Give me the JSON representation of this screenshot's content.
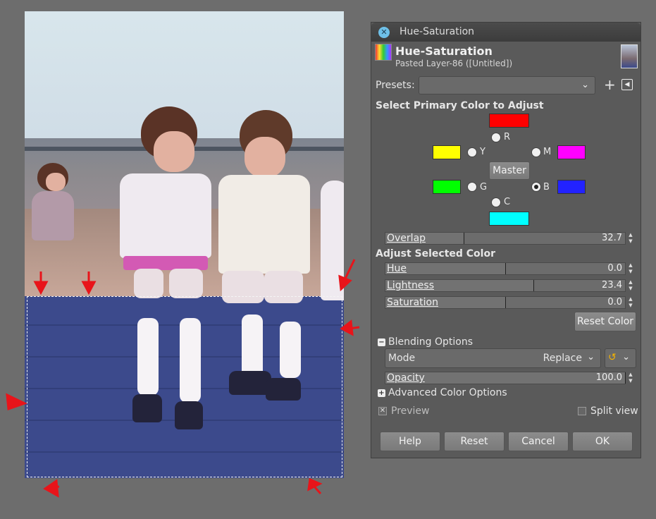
{
  "dialog": {
    "window_title": "Hue-Saturation",
    "heading": "Hue-Saturation",
    "subtitle": "Pasted Layer-86 ([Untitled])",
    "presets_label": "Presets:",
    "presets_value": "",
    "primary_color_heading": "Select Primary Color to Adjust",
    "colors": [
      {
        "key": "R",
        "label": "R",
        "color": "#ff0000",
        "selected": false
      },
      {
        "key": "Y",
        "label": "Y",
        "color": "#ffff00",
        "selected": false
      },
      {
        "key": "G",
        "label": "G",
        "color": "#00ff00",
        "selected": false
      },
      {
        "key": "C",
        "label": "C",
        "color": "#00ffff",
        "selected": false
      },
      {
        "key": "B",
        "label": "B",
        "color": "#2222ff",
        "selected": true
      },
      {
        "key": "M",
        "label": "M",
        "color": "#ff00ff",
        "selected": false
      }
    ],
    "master_label": "Master",
    "overlap": {
      "label": "Overlap",
      "value": "32.7",
      "fraction": 0.327
    },
    "adjust_heading": "Adjust Selected Color",
    "hue": {
      "label": "Hue",
      "value": "0.0",
      "fraction": 0.5
    },
    "lightness": {
      "label": "Lightness",
      "value": "23.4",
      "fraction": 0.617
    },
    "saturation": {
      "label": "Saturation",
      "value": "0.0",
      "fraction": 0.5
    },
    "reset_color_label": "Reset Color",
    "blending_label": "Blending Options",
    "mode_label": "Mode",
    "mode_value": "Replace",
    "opacity": {
      "label": "Opacity",
      "value": "100.0",
      "fraction": 1.0
    },
    "advanced_label": "Advanced Color Options",
    "preview_label": "Preview",
    "preview_checked": true,
    "split_label": "Split view",
    "split_checked": false,
    "buttons": {
      "help": "Help",
      "reset": "Reset",
      "cancel": "Cancel",
      "ok": "OK"
    }
  },
  "colors": {
    "arrow": "#e8141a",
    "selection_fill": "#3c4a8c"
  }
}
